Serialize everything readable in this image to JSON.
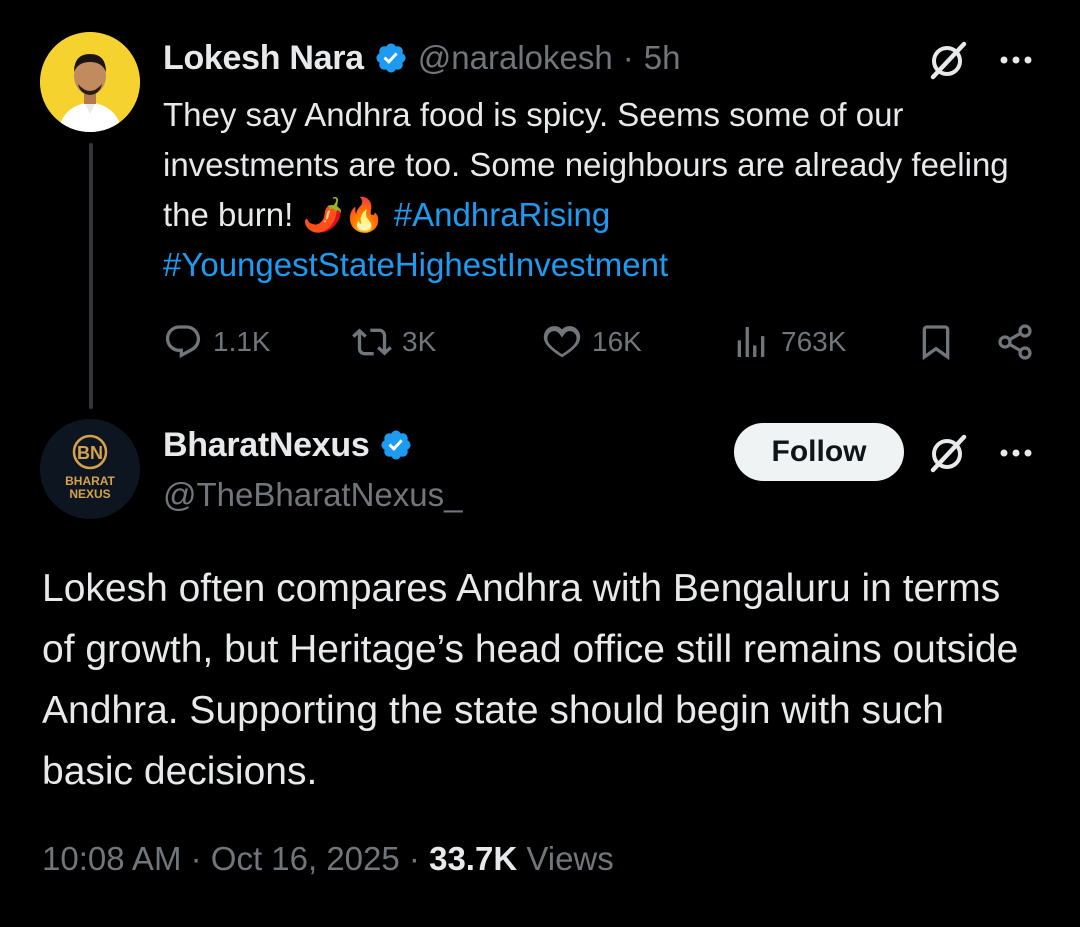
{
  "quoted_tweet": {
    "author_name": "Lokesh Nara",
    "handle": "@naralokesh",
    "separator": "·",
    "time": "5h",
    "text_plain": "They say Andhra food is spicy. Seems some of our investments are too. Some neighbours are already feeling the burn!",
    "emojis": "🌶️🔥",
    "hashtag_1": "#AndhraRising",
    "hashtag_2": "#YoungestStateHighestInvestment",
    "replies": "1.1K",
    "reposts": "3K",
    "likes": "16K",
    "views": "763K"
  },
  "main_tweet": {
    "author_name": "BharatNexus",
    "handle": "@TheBharatNexus_",
    "follow_label": "Follow",
    "avatar_monogram": "BN",
    "avatar_line_1": "BHARAT",
    "avatar_line_2": "NEXUS",
    "text": "Lokesh often compares Andhra with Bengaluru in terms of growth, but Heritage’s head office still remains outside Andhra. Supporting the state should begin with such basic decisions.",
    "time": "10:08 AM",
    "dot_1": "·",
    "date": "Oct 16, 2025",
    "dot_2": "·",
    "view_count": "33.7K",
    "views_label": "Views"
  },
  "colors": {
    "background": "#000000",
    "text_primary": "#e7e9ea",
    "text_secondary": "#71767b",
    "link_blue": "#1d9bf0",
    "verified_blue": "#1d9bf0",
    "follow_bg": "#eff3f4"
  },
  "icons": [
    "verified-badge-icon",
    "grok-icon",
    "more-icon",
    "reply-icon",
    "repost-icon",
    "like-icon",
    "views-icon",
    "bookmark-icon",
    "share-icon"
  ]
}
